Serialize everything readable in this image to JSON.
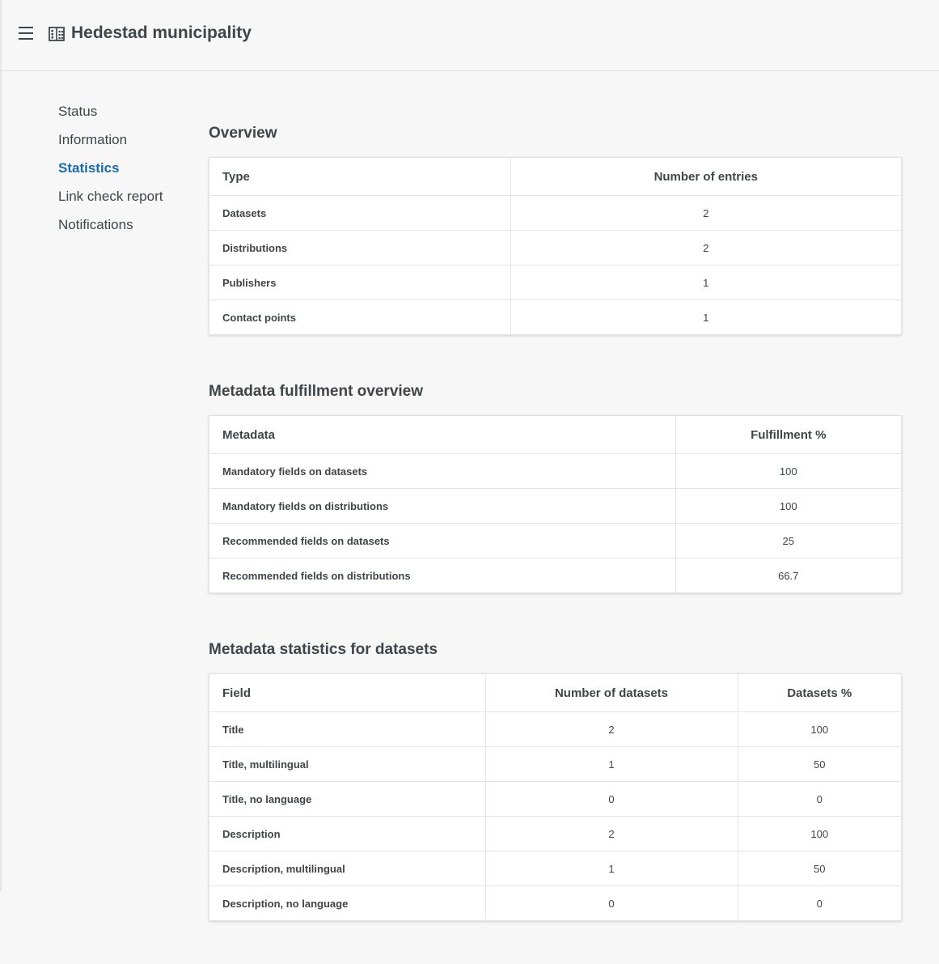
{
  "header": {
    "title": "Hedestad municipality"
  },
  "icons": {
    "menu": "menu-icon",
    "building": "building-icon"
  },
  "nav": {
    "items": [
      {
        "label": "Status"
      },
      {
        "label": "Information"
      },
      {
        "label": "Statistics"
      },
      {
        "label": "Link check report"
      },
      {
        "label": "Notifications"
      }
    ],
    "active_color": "#1a6bb5"
  },
  "overview": {
    "title": "Overview",
    "columns": [
      "Type",
      "Number of entries"
    ],
    "rows": [
      [
        "Datasets",
        "2"
      ],
      [
        "Distributions",
        "2"
      ],
      [
        "Publishers",
        "1"
      ],
      [
        "Contact points",
        "1"
      ]
    ]
  },
  "fulfillment": {
    "title": "Metadata fulfillment overview",
    "columns": [
      "Metadata",
      "Fulfillment %"
    ],
    "rows": [
      [
        "Mandatory fields on datasets",
        "100"
      ],
      [
        "Mandatory fields on distributions",
        "100"
      ],
      [
        "Recommended fields on datasets",
        "25"
      ],
      [
        "Recommended fields on distributions",
        "66.7"
      ]
    ]
  },
  "dataset_stats": {
    "title": "Metadata statistics for datasets",
    "columns": [
      "Field",
      "Number of datasets",
      "Datasets %"
    ],
    "rows": [
      [
        "Title",
        "2",
        "100"
      ],
      [
        "Title, multilingual",
        "1",
        "50"
      ],
      [
        "Title, no language",
        "0",
        "0"
      ],
      [
        "Description",
        "2",
        "100"
      ],
      [
        "Description, multilingual",
        "1",
        "50"
      ],
      [
        "Description, no language",
        "0",
        "0"
      ]
    ]
  }
}
